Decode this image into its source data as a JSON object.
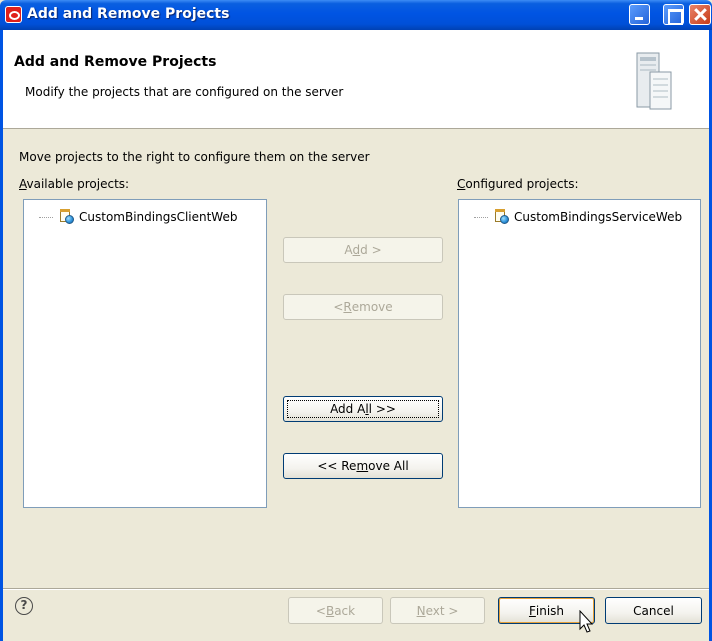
{
  "window": {
    "title": "Add and Remove Projects"
  },
  "header": {
    "title": "Add and Remove Projects",
    "description": "Modify the projects that are configured on the server"
  },
  "content": {
    "instruction": "Move projects to the right to configure them on the server",
    "available_label_mnemonic": "A",
    "available_label_rest": "vailable projects:",
    "configured_label_mnemonic": "C",
    "configured_label_rest": "onfigured projects:",
    "available_projects": [
      "CustomBindingsClientWeb"
    ],
    "configured_projects": [
      "CustomBindingsServiceWeb"
    ]
  },
  "buttons": {
    "add": {
      "pre": "A",
      "mn": "d",
      "post": "d >",
      "enabled": false
    },
    "remove": {
      "pre": "< ",
      "mn": "R",
      "post": "emove",
      "enabled": false
    },
    "add_all": {
      "pre": "Add A",
      "mn": "l",
      "post": "l >>",
      "enabled": true
    },
    "remove_all": {
      "pre": "<< Re",
      "mn": "m",
      "post": "ove All",
      "enabled": true
    }
  },
  "footer": {
    "help_symbol": "?",
    "back": {
      "pre": "< ",
      "mn": "B",
      "post": "ack",
      "enabled": false
    },
    "next": {
      "pre": "",
      "mn": "N",
      "post": "ext >",
      "enabled": false
    },
    "finish": {
      "pre": "",
      "mn": "F",
      "post": "inish",
      "enabled": true
    },
    "cancel": {
      "label": "Cancel",
      "enabled": true
    }
  },
  "icons": {
    "app": "oracle-logo-icon",
    "server": "server-icon",
    "project": "web-project-icon",
    "help": "help-icon"
  },
  "colors": {
    "titlebar": "#0054e3",
    "dialog_bg": "#ece9d8",
    "focus_border": "#003c74"
  }
}
